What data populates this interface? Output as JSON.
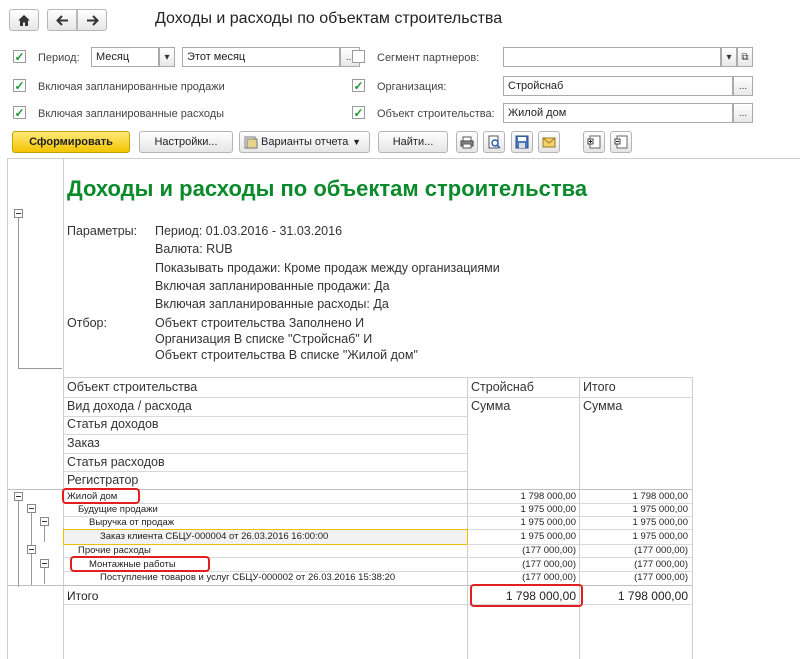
{
  "window_title": "Доходы и расходы по объектам строительства",
  "nav": {
    "home_icon": "home-icon",
    "back_icon": "arrow-left-icon",
    "forward_icon": "arrow-right-icon"
  },
  "form": {
    "period_label": "Период:",
    "period_type": "Месяц",
    "period_value": "Этот месяц",
    "include_planned_sales_label": "Включая запланированные продажи",
    "include_planned_expenses_label": "Включая запланированные расходы",
    "segment_label": "Сегмент партнеров:",
    "segment_value": "",
    "organization_label": "Организация:",
    "organization_value": "Стройснаб",
    "object_label": "Объект строительства:",
    "object_value": "Жилой дом",
    "dots": "...",
    "dropdown": "▾",
    "open": "⧉",
    "check": "✓"
  },
  "toolbar": {
    "generate": "Сформировать",
    "settings": "Настройки...",
    "variants": "Варианты отчета",
    "find": "Найти..."
  },
  "report": {
    "title": "Доходы и расходы по объектам строительства",
    "params_label": "Параметры:",
    "params": [
      "Период: 01.03.2016 - 31.03.2016",
      "Валюта: RUB",
      "Показывать продажи: Кроме продаж между организациями",
      "Включая запланированные продажи: Да",
      "Включая запланированные расходы: Да"
    ],
    "filter_label": "Отбор:",
    "filters": [
      "Объект строительства Заполнено И",
      "Организация В списке \"Стройснаб\" И",
      "Объект строительства В списке \"Жилой дом\""
    ],
    "header_rows": [
      "Объект строительства",
      "Вид дохода / расхода",
      "Статья доходов",
      "Заказ",
      "Статья расходов",
      "Регистратор"
    ],
    "col1_header": "Стройснаб",
    "col2_header": "Итого",
    "col1_sub": "Сумма",
    "col2_sub": "Сумма",
    "rows": [
      {
        "label": "Жилой дом",
        "v1": "1 798 000,00",
        "v2": "1 798 000,00"
      },
      {
        "label": "Будущие продажи",
        "v1": "1 975 000,00",
        "v2": "1 975 000,00"
      },
      {
        "label": "Выручка от продаж",
        "v1": "1 975 000,00",
        "v2": "1 975 000,00"
      },
      {
        "label": "Заказ клиента СБЦУ-000004 от 26.03.2016 16:00:00",
        "v1": "1 975 000,00",
        "v2": "1 975 000,00"
      },
      {
        "label": "Прочие расходы",
        "v1": "(177 000,00)",
        "v2": "(177 000,00)"
      },
      {
        "label": "Монтажные работы",
        "v1": "(177 000,00)",
        "v2": "(177 000,00)"
      },
      {
        "label": "Поступление товаров и услуг СБЦУ-000002 от 26.03.2016 15:38:20",
        "v1": "(177 000,00)",
        "v2": "(177 000,00)"
      }
    ],
    "total_label": "Итого",
    "total_v1": "1 798 000,00",
    "total_v2": "1 798 000,00"
  },
  "colors": {
    "accent_green": "#0a8a2a",
    "primary_button": "#f3c400",
    "highlight_red": "#e02020",
    "selection_yellow": "#f0c000"
  }
}
